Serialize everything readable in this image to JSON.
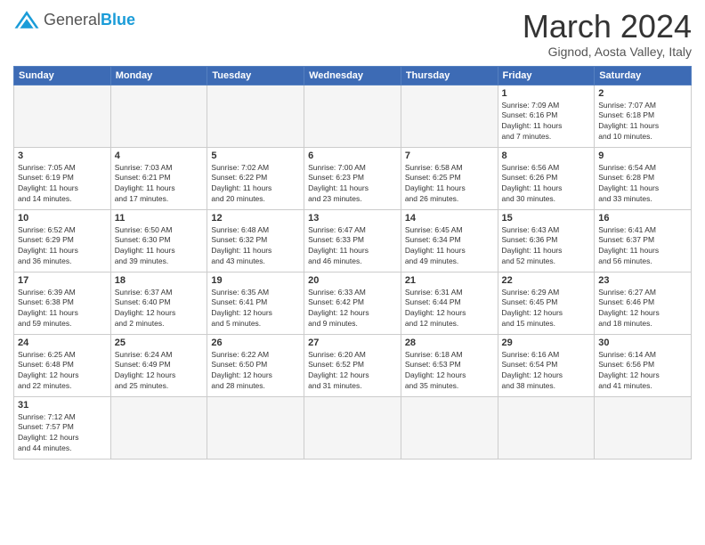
{
  "header": {
    "logo_general": "General",
    "logo_blue": "Blue",
    "title": "March 2024",
    "subtitle": "Gignod, Aosta Valley, Italy"
  },
  "weekdays": [
    "Sunday",
    "Monday",
    "Tuesday",
    "Wednesday",
    "Thursday",
    "Friday",
    "Saturday"
  ],
  "weeks": [
    [
      {
        "day": "",
        "info": ""
      },
      {
        "day": "",
        "info": ""
      },
      {
        "day": "",
        "info": ""
      },
      {
        "day": "",
        "info": ""
      },
      {
        "day": "",
        "info": ""
      },
      {
        "day": "1",
        "info": "Sunrise: 7:09 AM\nSunset: 6:16 PM\nDaylight: 11 hours\nand 7 minutes."
      },
      {
        "day": "2",
        "info": "Sunrise: 7:07 AM\nSunset: 6:18 PM\nDaylight: 11 hours\nand 10 minutes."
      }
    ],
    [
      {
        "day": "3",
        "info": "Sunrise: 7:05 AM\nSunset: 6:19 PM\nDaylight: 11 hours\nand 14 minutes."
      },
      {
        "day": "4",
        "info": "Sunrise: 7:03 AM\nSunset: 6:21 PM\nDaylight: 11 hours\nand 17 minutes."
      },
      {
        "day": "5",
        "info": "Sunrise: 7:02 AM\nSunset: 6:22 PM\nDaylight: 11 hours\nand 20 minutes."
      },
      {
        "day": "6",
        "info": "Sunrise: 7:00 AM\nSunset: 6:23 PM\nDaylight: 11 hours\nand 23 minutes."
      },
      {
        "day": "7",
        "info": "Sunrise: 6:58 AM\nSunset: 6:25 PM\nDaylight: 11 hours\nand 26 minutes."
      },
      {
        "day": "8",
        "info": "Sunrise: 6:56 AM\nSunset: 6:26 PM\nDaylight: 11 hours\nand 30 minutes."
      },
      {
        "day": "9",
        "info": "Sunrise: 6:54 AM\nSunset: 6:28 PM\nDaylight: 11 hours\nand 33 minutes."
      }
    ],
    [
      {
        "day": "10",
        "info": "Sunrise: 6:52 AM\nSunset: 6:29 PM\nDaylight: 11 hours\nand 36 minutes."
      },
      {
        "day": "11",
        "info": "Sunrise: 6:50 AM\nSunset: 6:30 PM\nDaylight: 11 hours\nand 39 minutes."
      },
      {
        "day": "12",
        "info": "Sunrise: 6:48 AM\nSunset: 6:32 PM\nDaylight: 11 hours\nand 43 minutes."
      },
      {
        "day": "13",
        "info": "Sunrise: 6:47 AM\nSunset: 6:33 PM\nDaylight: 11 hours\nand 46 minutes."
      },
      {
        "day": "14",
        "info": "Sunrise: 6:45 AM\nSunset: 6:34 PM\nDaylight: 11 hours\nand 49 minutes."
      },
      {
        "day": "15",
        "info": "Sunrise: 6:43 AM\nSunset: 6:36 PM\nDaylight: 11 hours\nand 52 minutes."
      },
      {
        "day": "16",
        "info": "Sunrise: 6:41 AM\nSunset: 6:37 PM\nDaylight: 11 hours\nand 56 minutes."
      }
    ],
    [
      {
        "day": "17",
        "info": "Sunrise: 6:39 AM\nSunset: 6:38 PM\nDaylight: 11 hours\nand 59 minutes."
      },
      {
        "day": "18",
        "info": "Sunrise: 6:37 AM\nSunset: 6:40 PM\nDaylight: 12 hours\nand 2 minutes."
      },
      {
        "day": "19",
        "info": "Sunrise: 6:35 AM\nSunset: 6:41 PM\nDaylight: 12 hours\nand 5 minutes."
      },
      {
        "day": "20",
        "info": "Sunrise: 6:33 AM\nSunset: 6:42 PM\nDaylight: 12 hours\nand 9 minutes."
      },
      {
        "day": "21",
        "info": "Sunrise: 6:31 AM\nSunset: 6:44 PM\nDaylight: 12 hours\nand 12 minutes."
      },
      {
        "day": "22",
        "info": "Sunrise: 6:29 AM\nSunset: 6:45 PM\nDaylight: 12 hours\nand 15 minutes."
      },
      {
        "day": "23",
        "info": "Sunrise: 6:27 AM\nSunset: 6:46 PM\nDaylight: 12 hours\nand 18 minutes."
      }
    ],
    [
      {
        "day": "24",
        "info": "Sunrise: 6:25 AM\nSunset: 6:48 PM\nDaylight: 12 hours\nand 22 minutes."
      },
      {
        "day": "25",
        "info": "Sunrise: 6:24 AM\nSunset: 6:49 PM\nDaylight: 12 hours\nand 25 minutes."
      },
      {
        "day": "26",
        "info": "Sunrise: 6:22 AM\nSunset: 6:50 PM\nDaylight: 12 hours\nand 28 minutes."
      },
      {
        "day": "27",
        "info": "Sunrise: 6:20 AM\nSunset: 6:52 PM\nDaylight: 12 hours\nand 31 minutes."
      },
      {
        "day": "28",
        "info": "Sunrise: 6:18 AM\nSunset: 6:53 PM\nDaylight: 12 hours\nand 35 minutes."
      },
      {
        "day": "29",
        "info": "Sunrise: 6:16 AM\nSunset: 6:54 PM\nDaylight: 12 hours\nand 38 minutes."
      },
      {
        "day": "30",
        "info": "Sunrise: 6:14 AM\nSunset: 6:56 PM\nDaylight: 12 hours\nand 41 minutes."
      }
    ],
    [
      {
        "day": "31",
        "info": "Sunrise: 7:12 AM\nSunset: 7:57 PM\nDaylight: 12 hours\nand 44 minutes."
      },
      {
        "day": "",
        "info": ""
      },
      {
        "day": "",
        "info": ""
      },
      {
        "day": "",
        "info": ""
      },
      {
        "day": "",
        "info": ""
      },
      {
        "day": "",
        "info": ""
      },
      {
        "day": "",
        "info": ""
      }
    ]
  ]
}
